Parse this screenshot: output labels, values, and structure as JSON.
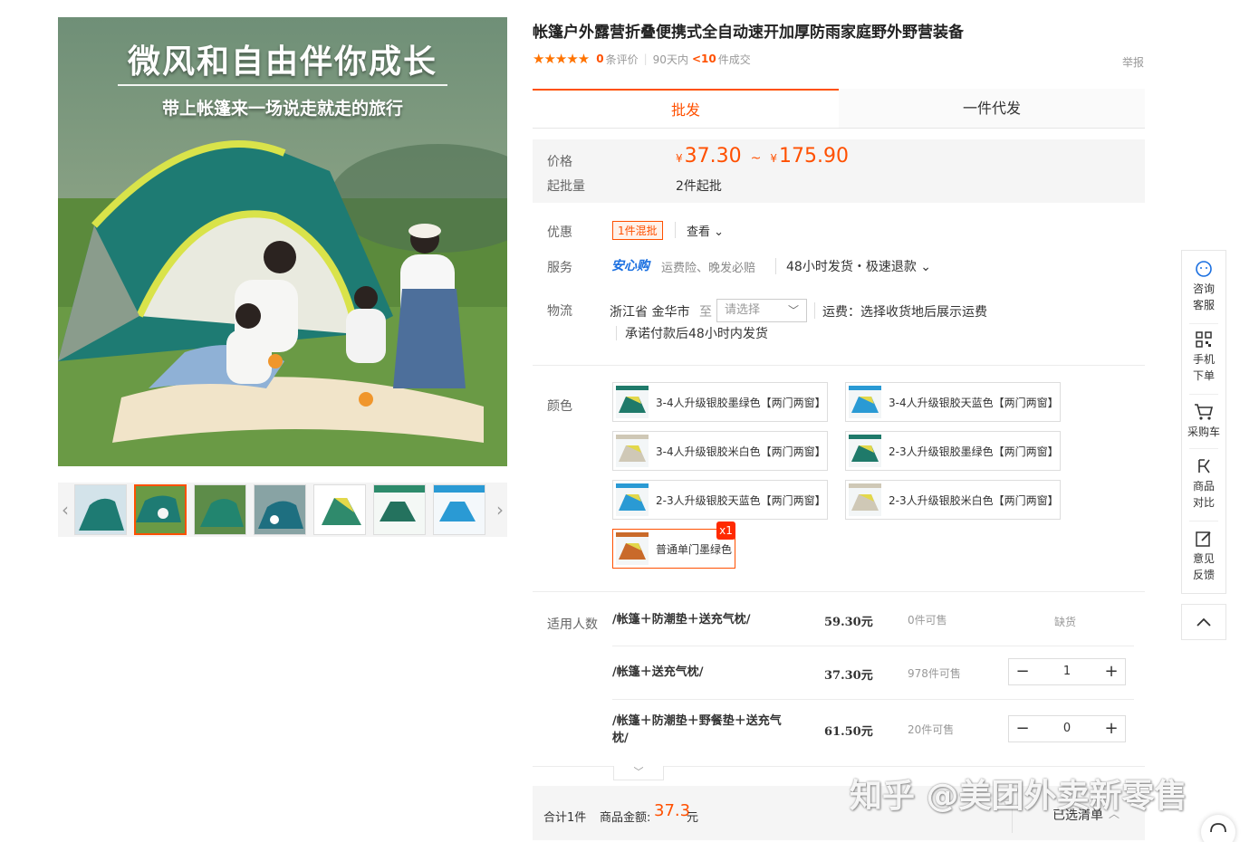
{
  "gallery": {
    "hero_title": "微风和自由伴你成长",
    "hero_subtitle": "带上帐篷来一场说走就走的旅行",
    "prev_icon": "chevron-left-icon",
    "next_icon": "chevron-right-icon"
  },
  "product": {
    "title": "帐篷户外露营折叠便携式全自动速开加厚防雨家庭野外野营装备",
    "stars": "★★★★★",
    "review_count": "0",
    "review_label": "条评价",
    "sales_prefix": "90天内",
    "sales_value": "<10",
    "sales_suffix": "件成交",
    "report": "举报"
  },
  "tabs": {
    "wholesale": "批发",
    "dropship": "一件代发"
  },
  "price": {
    "label": "价格",
    "currency": "¥",
    "low": "37.30",
    "tilde": "~",
    "high": "175.90",
    "moq_label": "起批量",
    "moq_value": "2件起批"
  },
  "promo": {
    "label": "优惠",
    "badge": "1件混批",
    "view": "查看 ⌄"
  },
  "service": {
    "label": "服务",
    "logo": "安心购",
    "text": "运费险、晚发必赔",
    "shipping": "48小时发货・极速退款 ⌄"
  },
  "logistics": {
    "label": "物流",
    "from": "浙江省 金华市",
    "to": "至",
    "select_placeholder": "请选择",
    "freight": "运费：选择收货地后展示运费",
    "promise": "承诺付款后48小时内发货"
  },
  "colors": {
    "label": "颜色",
    "options": [
      {
        "name": "3-4人升级银胶墨绿色【两门两窗】",
        "swatch": "#1f7a6a"
      },
      {
        "name": "3-4人升级银胶天蓝色【两门两窗】",
        "swatch": "#2a9ad4"
      },
      {
        "name": "3-4人升级银胶米白色【两门两窗】",
        "swatch": "#cfc8b6"
      },
      {
        "name": "2-3人升级银胶墨绿色【两门两窗】",
        "swatch": "#1f7a6a"
      },
      {
        "name": "2-3人升级银胶天蓝色【两门两窗】",
        "swatch": "#2a9ad4"
      },
      {
        "name": "2-3人升级银胶米白色【两门两窗】",
        "swatch": "#cfc8b6"
      },
      {
        "name": "普通单门墨绿色",
        "swatch": "#c96a2a"
      }
    ],
    "selected_badge": "x1"
  },
  "sku": {
    "label": "适用人数",
    "rows": [
      {
        "name": "/帐篷＋防潮垫＋送充气枕/",
        "price": "59.30元",
        "stock": "0件可售",
        "status": "缺货"
      },
      {
        "name": "/帐篷＋送充气枕/",
        "price": "37.30元",
        "stock": "978件可售",
        "qty": "1"
      },
      {
        "name": "/帐篷＋防潮垫＋野餐垫＋送充气枕/",
        "price": "61.50元",
        "stock": "20件可售",
        "qty": "0"
      }
    ],
    "minus": "−",
    "plus": "+"
  },
  "footer": {
    "count": "合计1件",
    "amount_label": "商品金额:",
    "amount": "37.3",
    "unit": "元",
    "selected_list": "已选清单"
  },
  "side": {
    "consult": "咨询\n客服",
    "mobile": "手机\n下单",
    "cart": "采购车",
    "compare": "商品\n对比",
    "feedback": "意见\n反馈"
  },
  "watermark": "知乎 @美团外卖新零售",
  "colors_theme": {
    "accent": "#ff5000",
    "link": "#1a6fe0"
  }
}
